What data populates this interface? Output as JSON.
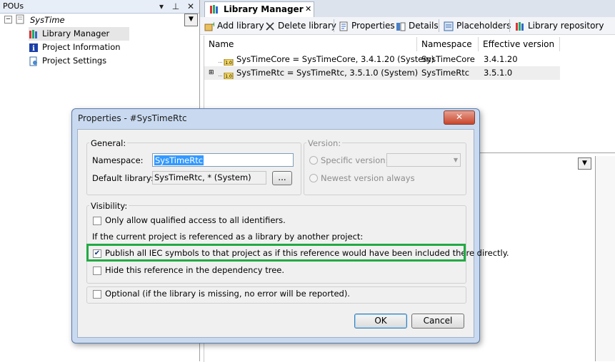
{
  "pou_panel": {
    "title": "POUs",
    "pin_glyph": "▾",
    "dock_glyph": "⊥",
    "close_glyph": "✕",
    "root": "SysTime",
    "items": [
      {
        "label": "Library Manager",
        "icon": "library-books-icon"
      },
      {
        "label": "Project Information",
        "icon": "info-icon"
      },
      {
        "label": "Project Settings",
        "icon": "settings-doc-icon"
      }
    ]
  },
  "tabs": {
    "active": "Library Manager",
    "close_glyph": "✕"
  },
  "toolbar": {
    "add_library": "Add library",
    "delete_library": "Delete library",
    "properties": "Properties",
    "details": "Details",
    "placeholders": "Placeholders",
    "library_repository": "Library repository"
  },
  "library_table": {
    "columns": [
      "Name",
      "Namespace",
      "Effective version"
    ],
    "rows": [
      {
        "name": "SysTimeCore = SysTimeCore, 3.4.1.20 (System)",
        "namespace": "SysTimeCore",
        "version": "3.4.1.20"
      },
      {
        "name": "SysTimeRtc = SysTimeRtc, 3.5.1.0 (System)",
        "namespace": "SysTimeRtc",
        "version": "3.5.1.0"
      }
    ]
  },
  "dialog": {
    "title": "Properties - #SysTimeRtc",
    "close_glyph": "✕",
    "general": {
      "label": "General:",
      "namespace_label": "Namespace:",
      "namespace_value": "SysTimeRtc",
      "default_library_label": "Default library:",
      "default_library_value": "SysTimeRtc, * (System)",
      "browse_label": "..."
    },
    "version": {
      "label": "Version:",
      "specific_label": "Specific version:",
      "newest_label": "Newest version always"
    },
    "visibility": {
      "label": "Visibility:",
      "qualified_access": "Only allow qualified access to all identifiers.",
      "referenced_note": "If the current project is referenced as a library by another project:",
      "publish_symbols": "Publish all IEC symbols to that project as if this reference would have been included there directly.",
      "hide_reference": "Hide this reference in the dependency tree."
    },
    "optional": "Optional (if the library is missing, no error will be reported).",
    "ok": "OK",
    "cancel": "Cancel",
    "check_glyph": "✔"
  },
  "colors": {
    "highlight": "#22aa44",
    "accent": "#c8462c"
  }
}
